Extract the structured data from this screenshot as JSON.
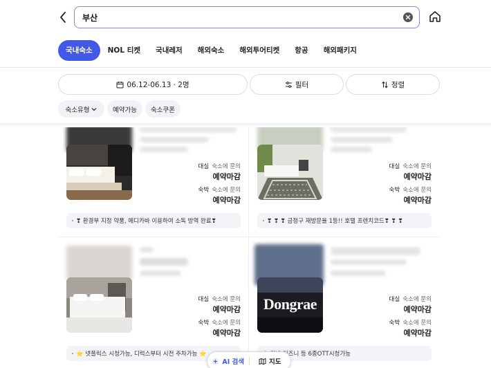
{
  "search": {
    "query": "부산"
  },
  "categories": [
    {
      "label": "국내숙소",
      "active": true
    },
    {
      "label": "NOL 티켓",
      "active": false
    },
    {
      "label": "국내레저",
      "active": false
    },
    {
      "label": "해외숙소",
      "active": false
    },
    {
      "label": "해외투어티켓",
      "active": false
    },
    {
      "label": "항공",
      "active": false
    },
    {
      "label": "해외패키지",
      "active": false
    }
  ],
  "filters": {
    "date_label": "06.12-06.13 · 2명",
    "filter_label": "필터",
    "sort_label": "정렬"
  },
  "chips": {
    "type_label": "숙소유형",
    "available_label": "예약가능",
    "coupon_label": "숙소쿠폰"
  },
  "listings": [
    {
      "rates": [
        {
          "type": "대실",
          "inquiry": "숙소에 문의",
          "status": "예약마감"
        },
        {
          "type": "숙박",
          "inquiry": "숙소에 문의",
          "status": "예약마감"
        }
      ],
      "promo": "❣ 환경부 지정 약품, 메디카바 이용하여 소독 방역 완료❣"
    },
    {
      "rates": [
        {
          "type": "대실",
          "inquiry": "숙소에 문의",
          "status": "예약마감"
        },
        {
          "type": "숙박",
          "inquiry": "숙소에 문의",
          "status": "예약마감"
        }
      ],
      "promo": "❣ ❣ ❣ 금정구 재방문율 1등!! 호텔 프렌치코드❣ ❣ ❣"
    },
    {
      "rates": [
        {
          "type": "대실",
          "inquiry": "숙소에 문의",
          "status": "예약마감"
        },
        {
          "type": "숙박",
          "inquiry": "숙소에 문의",
          "status": "예약마감"
        }
      ],
      "promo": "⭐ 넷플릭스 시청가능, 디럭스부터 시전 주차가능 ⭐"
    },
    {
      "rates": [
        {
          "type": "대실",
          "inquiry": "숙소에 문의",
          "status": "예약마감"
        },
        {
          "type": "숙박",
          "inquiry": "숙소에 문의",
          "status": "예약마감"
        }
      ],
      "promo": "스,티빙,디즈니 등 6종OTT시청가능",
      "sign_text": "Dongrae"
    }
  ],
  "floating": {
    "ai_search_label": "AI 검색",
    "map_label": "지도"
  },
  "colors": {
    "accent": "#4458e8",
    "search_border": "#7a8ae6",
    "promo_bg": "#f3f4f8",
    "chip_bg": "#f1f2f5"
  }
}
